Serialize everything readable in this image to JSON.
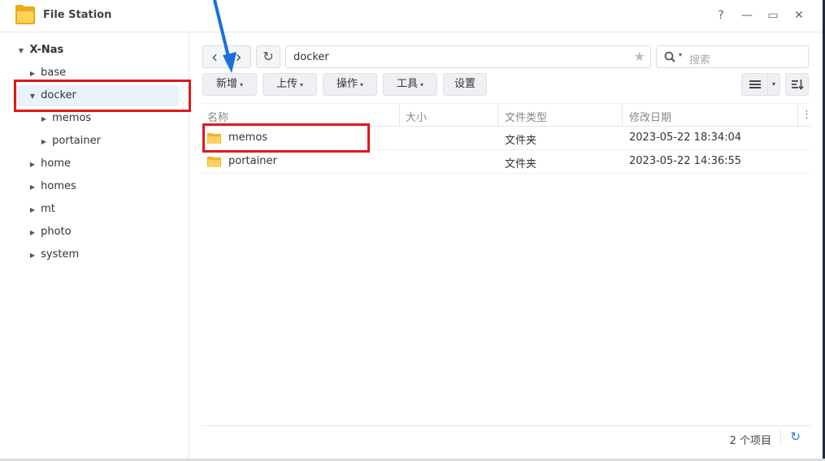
{
  "window": {
    "title": "File Station",
    "help_glyph": "?",
    "minimize_glyph": "—",
    "maximize_glyph": "▭",
    "close_glyph": "✕"
  },
  "sidebar": {
    "root": "X-Nas",
    "items": [
      {
        "label": "base",
        "expanded": false
      },
      {
        "label": "docker",
        "expanded": true,
        "selected": true
      },
      {
        "label": "memos",
        "expanded": false
      },
      {
        "label": "portainer",
        "expanded": false
      },
      {
        "label": "home",
        "expanded": false
      },
      {
        "label": "homes",
        "expanded": false
      },
      {
        "label": "mt",
        "expanded": false
      },
      {
        "label": "photo",
        "expanded": false
      },
      {
        "label": "system",
        "expanded": false
      }
    ]
  },
  "toolbar": {
    "back_glyph": "‹",
    "forward_glyph": "›",
    "refresh_glyph": "↻",
    "path": "docker",
    "star_glyph": "★",
    "search_placeholder": "搜索",
    "buttons": {
      "new": "新增",
      "upload": "上传",
      "action": "操作",
      "tools": "工具",
      "settings": "设置"
    },
    "caret": "▾"
  },
  "list": {
    "columns": {
      "name": "名称",
      "size": "大小",
      "type": "文件类型",
      "modified": "修改日期"
    },
    "menu_glyph": "⋮",
    "rows": [
      {
        "name": "memos",
        "size": "",
        "type": "文件夹",
        "modified": "2023-05-22 18:34:04"
      },
      {
        "name": "portainer",
        "size": "",
        "type": "文件夹",
        "modified": "2023-05-22 14:36:55"
      }
    ]
  },
  "footer": {
    "count": "2 个项目",
    "refresh_glyph": "↻"
  },
  "colors": {
    "accent": "#2a7ad6",
    "annotation_red": "#e0191b",
    "annotation_blue": "#1a6fe0",
    "folder": "#f2b32a"
  }
}
